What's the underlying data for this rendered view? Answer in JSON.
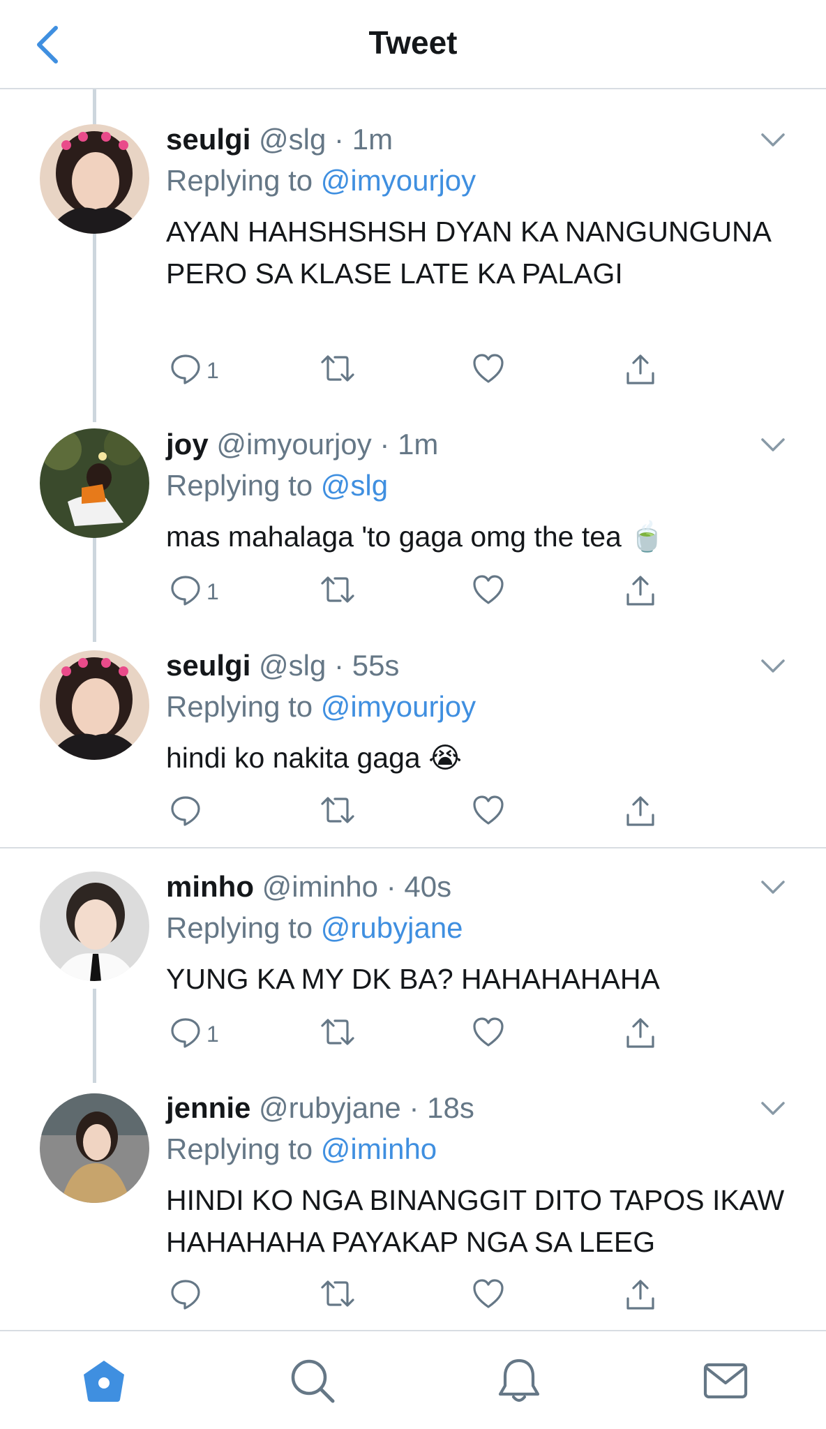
{
  "header": {
    "title": "Tweet"
  },
  "icons": {
    "back": "chevron-left-icon",
    "more": "chevron-down-icon",
    "reply": "reply-icon",
    "retweet": "retweet-icon",
    "like": "heart-icon",
    "share": "share-icon",
    "home": "home-icon",
    "search": "search-icon",
    "notifications": "bell-icon",
    "messages": "mail-icon"
  },
  "colors": {
    "accent": "#3f8fe0",
    "muted": "#657786",
    "text": "#14171a",
    "divider": "#d8dde2",
    "thread": "#cdd6dd"
  },
  "tweets": [
    {
      "name": "seulgi",
      "handle": "@slg",
      "time": "1m",
      "replying_label": "Replying to",
      "replying_to": "@imyourjoy",
      "text": "AYAN HAHSHSHSH DYAN KA NANGUNGUNA PERO SA KLASE LATE KA PALAGI",
      "reply_count": "1"
    },
    {
      "name": "joy",
      "handle": "@imyourjoy",
      "time": "1m",
      "replying_label": "Replying to",
      "replying_to": "@slg",
      "text": "mas mahalaga 'to gaga omg the tea 🍵",
      "reply_count": "1"
    },
    {
      "name": "seulgi",
      "handle": "@slg",
      "time": "55s",
      "replying_label": "Replying to",
      "replying_to": "@imyourjoy",
      "text": "hindi ko nakita gaga 😭",
      "reply_count": ""
    },
    {
      "name": "minho",
      "handle": "@iminho",
      "time": "40s",
      "replying_label": "Replying to",
      "replying_to": "@rubyjane",
      "text": "YUNG KA MY DK BA? HAHAHAHAHA",
      "reply_count": "1"
    },
    {
      "name": "jennie",
      "handle": "@rubyjane",
      "time": "18s",
      "replying_label": "Replying to",
      "replying_to": "@iminho",
      "text": "HINDI KO NGA BINANGGIT DITO TAPOS IKAW HAHAHAHA PAYAKAP NGA SA LEEG",
      "reply_count": ""
    }
  ],
  "separator": "·",
  "bottom_nav": {
    "active": "home"
  }
}
